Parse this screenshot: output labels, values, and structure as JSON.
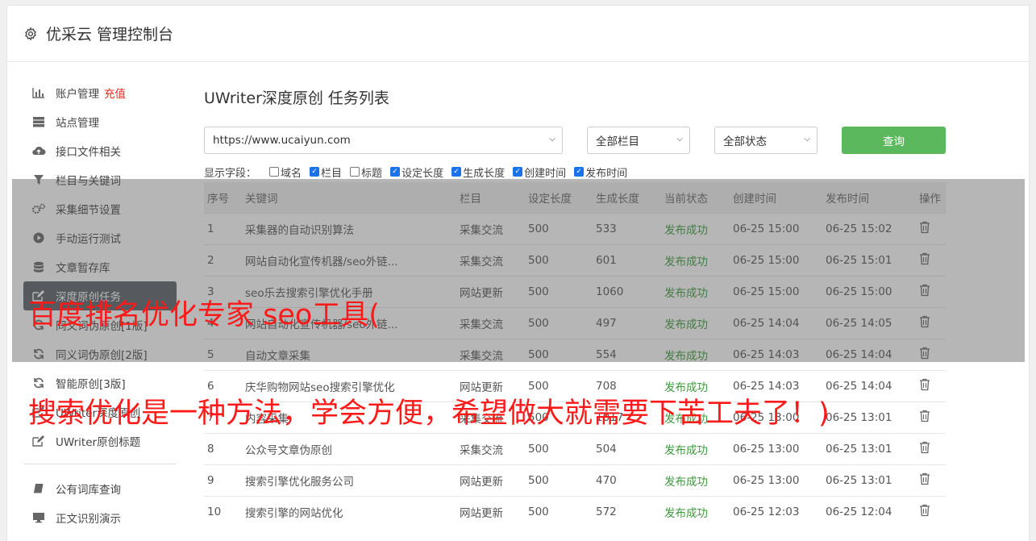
{
  "header": {
    "title": "优采云 管理控制台",
    "icon": "gear-icon"
  },
  "sidebar": {
    "items": [
      {
        "label": "账户管理",
        "extra": "充值",
        "icon": "bar-chart-icon"
      },
      {
        "label": "站点管理",
        "icon": "server-icon"
      },
      {
        "label": "接口文件相关",
        "icon": "cloud-upload-icon"
      },
      {
        "label": "栏目与关键词",
        "icon": "filter-icon"
      },
      {
        "label": "采集细节设置",
        "icon": "gears-icon"
      },
      {
        "label": "手动运行测试",
        "icon": "play-circle-icon"
      },
      {
        "label": "文章暂存库",
        "icon": "database-icon"
      },
      {
        "label": "深度原创任务",
        "icon": "edit-icon",
        "active": true
      },
      {
        "label": "同义词伪原创[1版]",
        "icon": "refresh-icon"
      },
      {
        "label": "同义词伪原创[2版]",
        "icon": "refresh-icon"
      },
      {
        "label": "智能原创[3版]",
        "icon": "refresh-icon"
      },
      {
        "label": "UWriter深度原创",
        "icon": "edit-icon"
      },
      {
        "label": "UWriter原创标题",
        "icon": "edit-icon"
      }
    ],
    "items2": [
      {
        "label": "公有词库查询",
        "icon": "book-icon"
      },
      {
        "label": "正文识别演示",
        "icon": "monitor-icon"
      }
    ]
  },
  "main": {
    "title": "UWriter深度原创 任务列表",
    "site_select": "https://www.ucaiyun.com",
    "column_select": "全部栏目",
    "status_select": "全部状态",
    "query_button": "查询",
    "fields_label": "显示字段：",
    "fields": [
      {
        "label": "域名",
        "checked": false
      },
      {
        "label": "栏目",
        "checked": true
      },
      {
        "label": "标题",
        "checked": false
      },
      {
        "label": "设定长度",
        "checked": true
      },
      {
        "label": "生成长度",
        "checked": true
      },
      {
        "label": "创建时间",
        "checked": true
      },
      {
        "label": "发布时间",
        "checked": true
      }
    ],
    "columns": [
      "序号",
      "关键词",
      "栏目",
      "设定长度",
      "生成长度",
      "当前状态",
      "创建时间",
      "发布时间",
      "操作"
    ],
    "rows": [
      [
        "1",
        "采集器的自动识别算法",
        "采集交流",
        "500",
        "533",
        "发布成功",
        "06-25 15:00",
        "06-25 15:02"
      ],
      [
        "2",
        "网站自动化宣传机器/seo外链...",
        "采集交流",
        "500",
        "601",
        "发布成功",
        "06-25 15:00",
        "06-25 15:01"
      ],
      [
        "3",
        "seo乐去搜索引擎优化手册",
        "网站更新",
        "500",
        "1060",
        "发布成功",
        "06-25 15:00",
        "06-25 15:00"
      ],
      [
        "4",
        "网站自动化宣传机器/seo外链...",
        "采集交流",
        "500",
        "497",
        "发布成功",
        "06-25 14:04",
        "06-25 14:05"
      ],
      [
        "5",
        "自动文章采集",
        "采集交流",
        "500",
        "554",
        "发布成功",
        "06-25 14:03",
        "06-25 14:04"
      ],
      [
        "6",
        "庆华购物网站seo搜索引擎优化",
        "网站更新",
        "500",
        "708",
        "发布成功",
        "06-25 14:03",
        "06-25 14:04"
      ],
      [
        "7",
        "内容采集",
        "采集交流",
        "500",
        "1017",
        "发布成功",
        "06-25 13:00",
        "06-25 13:01"
      ],
      [
        "8",
        "公众号文章伪原创",
        "采集交流",
        "500",
        "504",
        "发布成功",
        "06-25 13:00",
        "06-25 13:01"
      ],
      [
        "9",
        "搜索引擎优化服务公司",
        "网站更新",
        "500",
        "470",
        "发布成功",
        "06-25 13:00",
        "06-25 13:01"
      ],
      [
        "10",
        "搜索引擎的网站优化",
        "网站更新",
        "500",
        "572",
        "发布成功",
        "06-25 12:03",
        "06-25 12:04"
      ]
    ]
  },
  "overlay_text": {
    "line1": "百度排名优化专家 seo工具(",
    "line2": "搜索优化是一种方法，学会方便，希望做大就需要下苦工夫了！)"
  },
  "colors": {
    "accent_green": "#5cb85c",
    "status_green": "#3c9a3c",
    "overlay_red": "#ff1a1a"
  }
}
